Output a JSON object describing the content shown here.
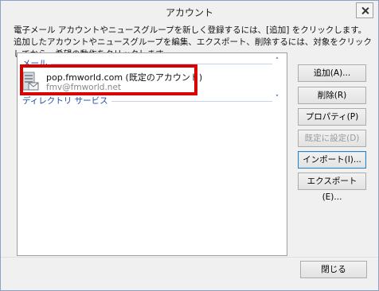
{
  "window": {
    "title": "アカウント"
  },
  "description": "電子メール アカウントやニュースグループを新しく登録するには、[追加] をクリックします。追加したアカウントやニュースグループを編集、エクスポート、削除するには、対象をクリックしてから、希望の動作をクリックします。",
  "groups": [
    {
      "label": "メール",
      "chevron": "˄"
    },
    {
      "label": "ディレクトリ サービス",
      "chevron": "˅"
    }
  ],
  "account": {
    "name": "pop.fmworld.com (既定のアカウント)",
    "email": "fmv@fmworld.net",
    "icon": "mail-server-icon"
  },
  "buttons": {
    "add": "追加(A)...",
    "delete": "削除(R)",
    "properties": "プロパティ(P)",
    "set_default": "既定に設定(D)",
    "import": "インポート(I)...",
    "export": "エクスポート(E)...",
    "close": "閉じる"
  },
  "colors": {
    "highlight": "#d90000",
    "group_text": "#1a49a8"
  }
}
